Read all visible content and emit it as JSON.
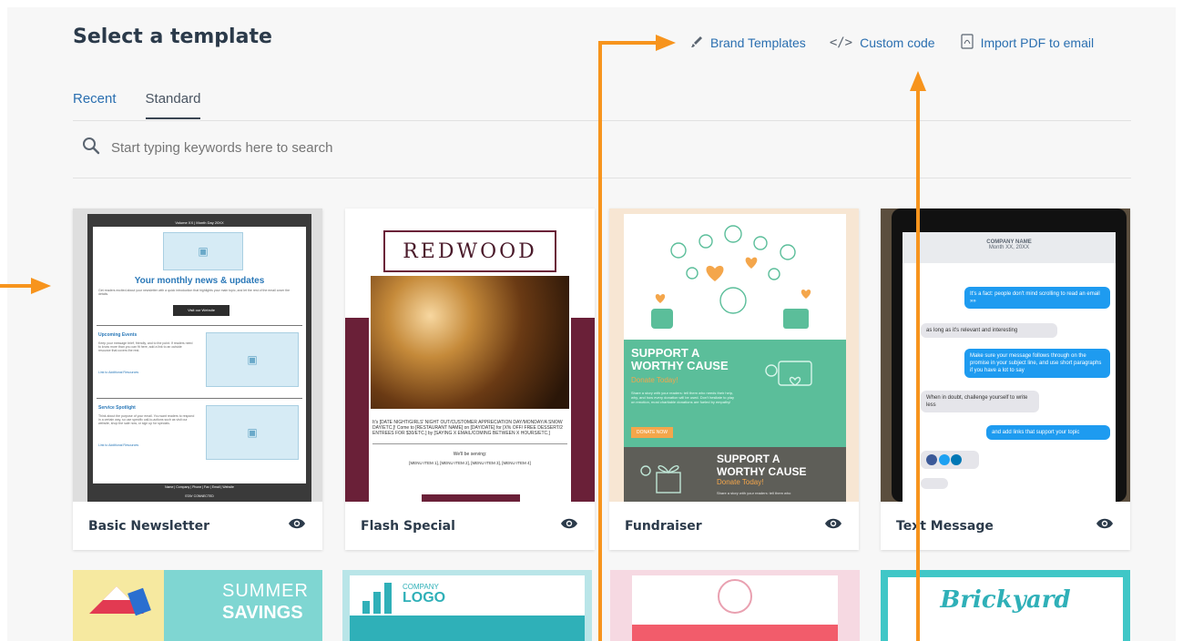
{
  "title": "Select a template",
  "header_links": [
    {
      "label": "Brand Templates",
      "icon": "brush-icon"
    },
    {
      "label": "Custom code",
      "icon": "code-icon"
    },
    {
      "label": "Import PDF to email",
      "icon": "pdf-icon"
    }
  ],
  "tabs": [
    {
      "label": "Recent",
      "active": false
    },
    {
      "label": "Standard",
      "active": true
    }
  ],
  "search": {
    "placeholder": "Start typing keywords here to search"
  },
  "templates": [
    {
      "name": "Basic Newsletter",
      "thumb": {
        "header": "Volume XX | Month Day 20XX",
        "headline": "Your monthly news & updates",
        "intro": "Get readers excited about your newsletter with a quick introduction that highlights your main topic, and let the rest of the email cover the details.",
        "button": "Visit our Website",
        "section1_title": "Upcoming Events",
        "section1_body": "Keep your message brief, friendly, and to the point. If readers need to know more than you can fit here, add a link to an outside resource that covers the rest.",
        "section1_link": "Link to Additional Resources",
        "section2_title": "Service Spotlight",
        "section2_body": "Think about the purpose of your email. You want readers to respond in a certain way, so use specific call-to-actions such as visit our website, shop the sale now, or sign up for specials.",
        "section2_link": "Link to Additional Resources",
        "footer": "Name | Company | Phone | Fax | Email | Website",
        "footer2": "STAY CONNECTED"
      }
    },
    {
      "name": "Flash Special",
      "thumb": {
        "logo": "REDWOOD",
        "body": "It's [DATE NIGHT/GIRLS' NIGHT OUT/CUSTOMER APPRECIATION DAY/MONDAY/A SNOW DAY/ETC.]! Come to [RESTAURANT NAME] on [DAY/DATE] for [X% OFF/ FREE DESSERT/2 ENTREES FOR $30/ETC.] by [SAYING X EMAIL/COMING BETWEEN X HOURS/ETC.]",
        "serving": "We'll be serving:",
        "menu": "[MENU ITEM 1], [MENU ITEM 2], [MENU ITEM 3], [MENU ITEM 4]"
      }
    },
    {
      "name": "Fundraiser",
      "thumb": {
        "headline": "SUPPORT A WORTHY CAUSE",
        "sub": "Donate Today!",
        "body": "Share a story with your readers: tell them who needs their help, why, and how every donation will be used. Don't hesitate to play on emotion, most charitable donations are fueled by empathy!",
        "button": "DONATE NOW",
        "headline2": "SUPPORT A WORTHY CAUSE",
        "sub2": "Donate Today!",
        "body2": "Share a story with your readers: tell them who"
      }
    },
    {
      "name": "Text Message",
      "thumb": {
        "company": "COMPANY NAME",
        "date": "Month XX, 20XX",
        "msg1": "It's a fact: people don't mind scrolling to read an email »»",
        "msg2": "as long as it's relevant and interesting",
        "msg3": "Make sure your message follows through on the promise in your subject line, and use short paragraphs if you have a lot to say",
        "msg4": "When in doubt, challenge yourself to write less",
        "msg5": "and add links that support your topic"
      }
    }
  ],
  "bottom_row": [
    {
      "text1": "SUMMER",
      "text2": "SAVINGS"
    },
    {
      "text1": "COMPANY",
      "text2": "LOGO"
    },
    {
      "text1": ""
    },
    {
      "text1": "Brickyard"
    }
  ],
  "colors": {
    "link": "#2a6fb0",
    "annotation_arrow": "#f7941d"
  }
}
